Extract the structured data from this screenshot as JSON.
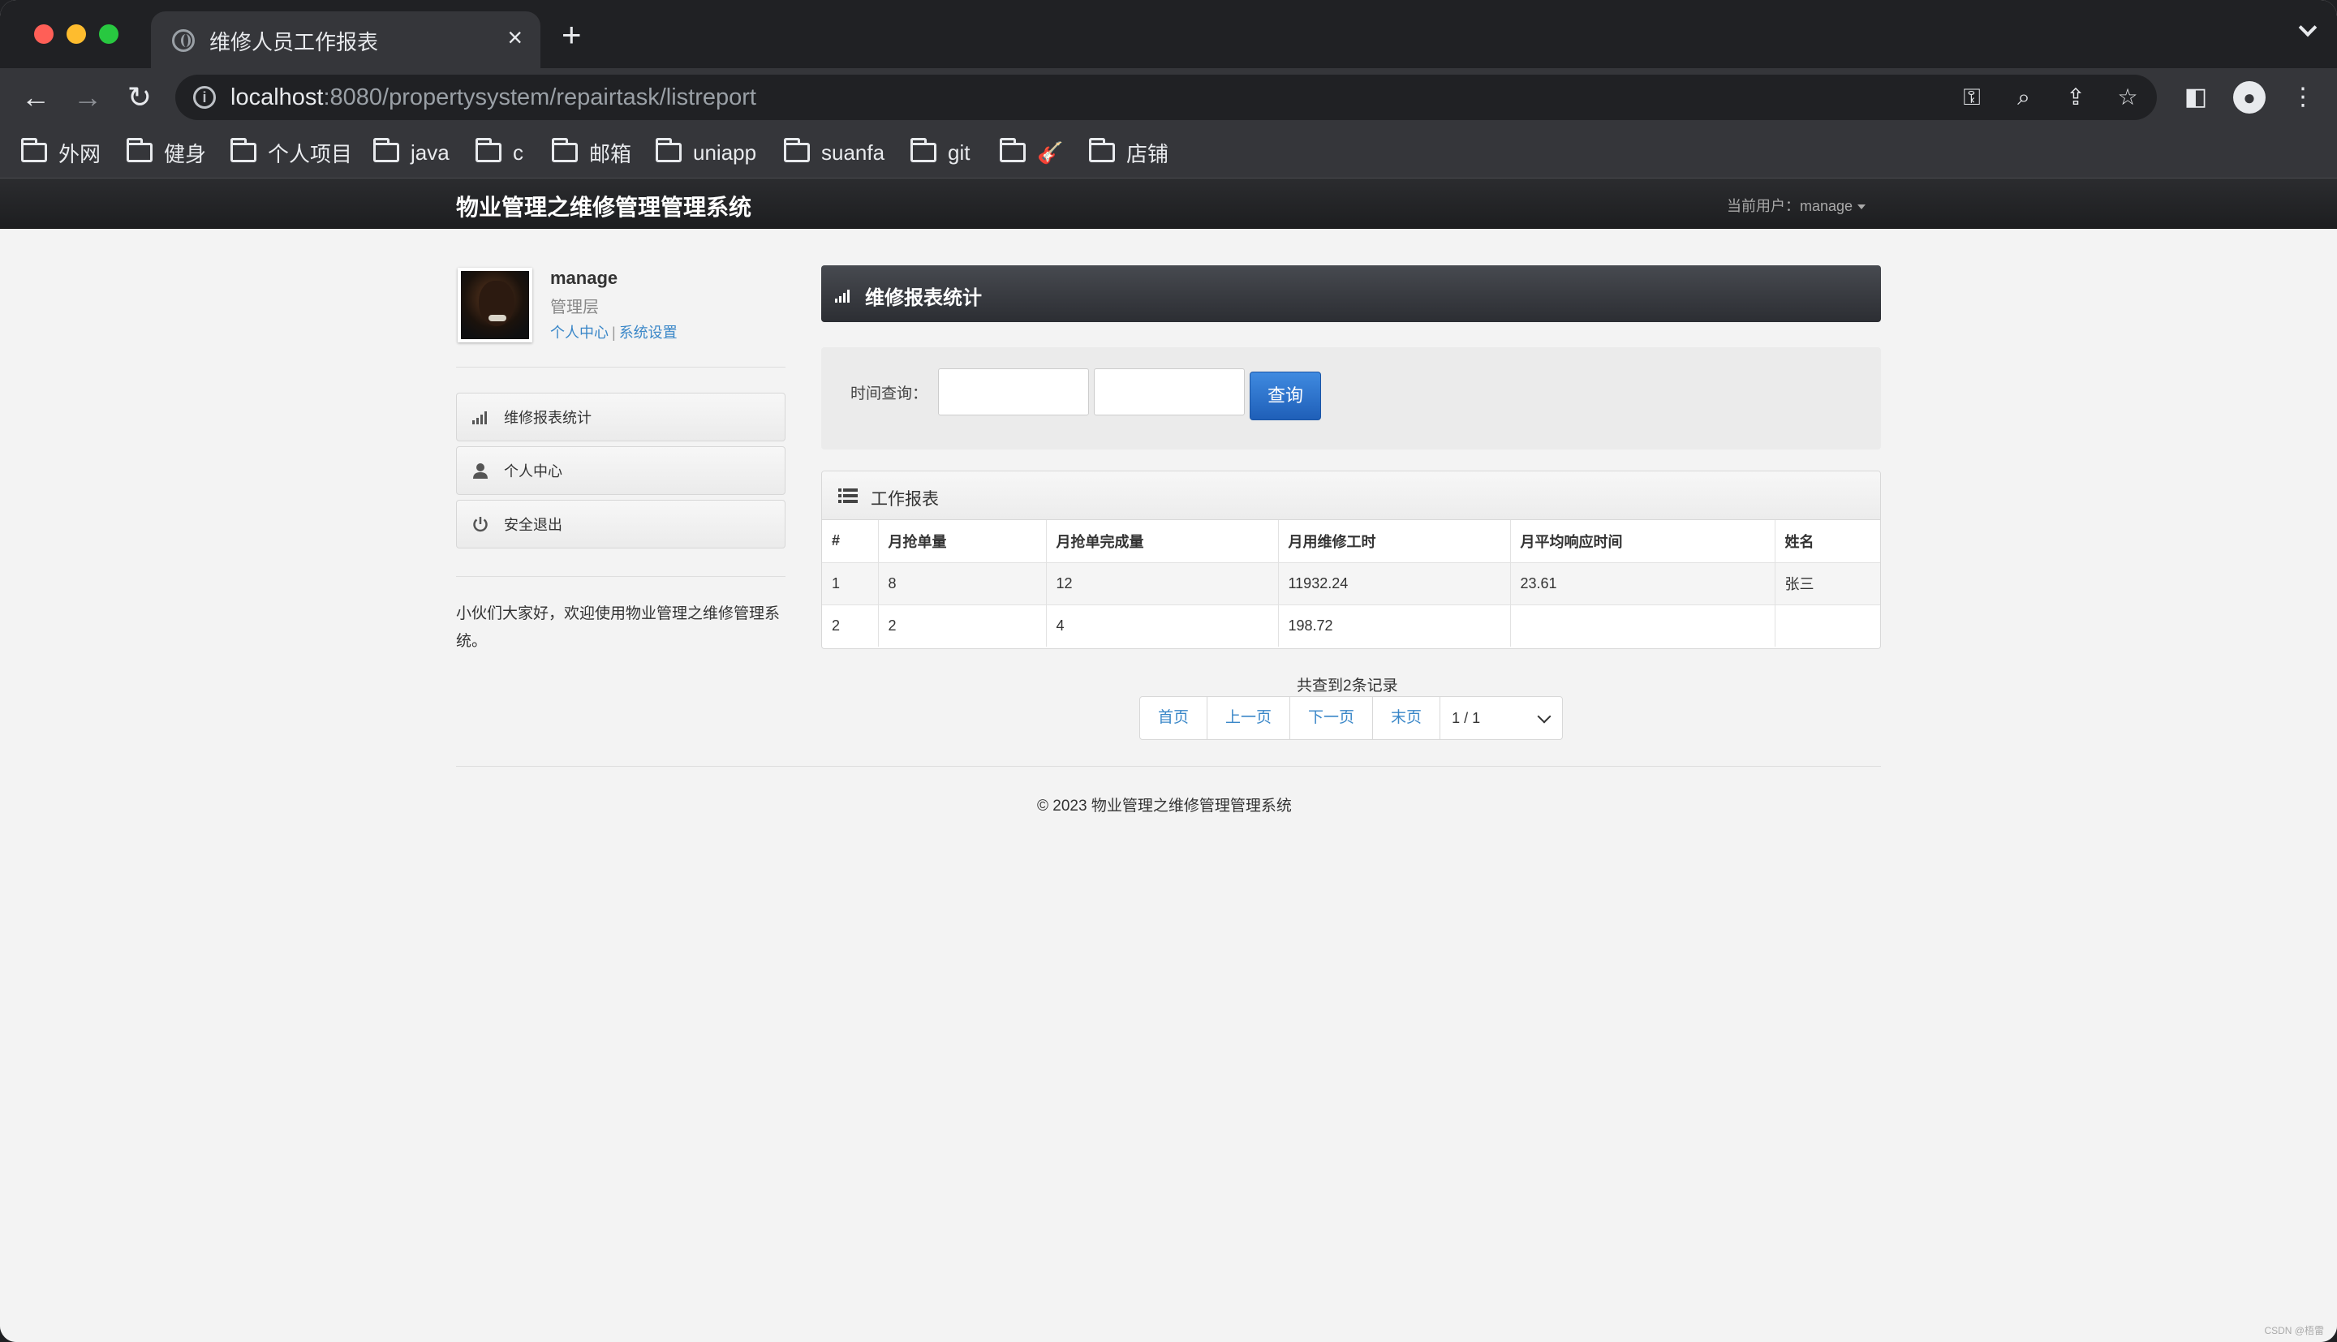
{
  "browser": {
    "tab_title": "维修人员工作报表",
    "tab_close": "×",
    "new_tab": "+",
    "url_host": "localhost",
    "url_rest": ":8080/propertysystem/repairtask/listreport",
    "bookmarks": [
      "外网",
      "健身",
      "个人项目",
      "java",
      "c",
      "邮箱",
      "uniapp",
      "suanfa",
      "git",
      "🎸",
      "店铺"
    ]
  },
  "navbar": {
    "brand": "物业管理之维修管理管理系统",
    "current_user_label": "当前用户：manage"
  },
  "profile": {
    "name": "manage",
    "role": "管理层",
    "link_center": "个人中心",
    "link_sep": "|",
    "link_settings": "系统设置"
  },
  "sidebar": {
    "items": [
      {
        "label": "维修报表统计",
        "icon": "signal-icon"
      },
      {
        "label": "个人中心",
        "icon": "user-icon"
      },
      {
        "label": "安全退出",
        "icon": "power-icon"
      }
    ],
    "welcome": "小伙们大家好，欢迎使用物业管理之维修管理系统。"
  },
  "main": {
    "section_title": "维修报表统计",
    "search_label": "时间查询：",
    "query_button": "查询",
    "report_title": "工作报表",
    "columns": [
      "#",
      "月抢单量",
      "月抢单完成量",
      "月用维修工时",
      "月平均响应时间",
      "姓名"
    ],
    "rows": [
      [
        "1",
        "8",
        "12",
        "11932.24",
        "23.61",
        "张三"
      ],
      [
        "2",
        "2",
        "4",
        "198.72",
        "",
        ""
      ]
    ],
    "records_text": "共查到2条记录",
    "pager": {
      "first": "首页",
      "prev": "上一页",
      "next": "下一页",
      "last": "末页",
      "page_select": "1 / 1"
    }
  },
  "footer": {
    "copyright": "© 2023 物业管理之维修管理管理系统"
  },
  "watermark": "CSDN @梧雷",
  "colors": {
    "accent_blue": "#2f76cf",
    "link_blue": "#3a87c8",
    "navbar_dark": "#1d1e20"
  }
}
